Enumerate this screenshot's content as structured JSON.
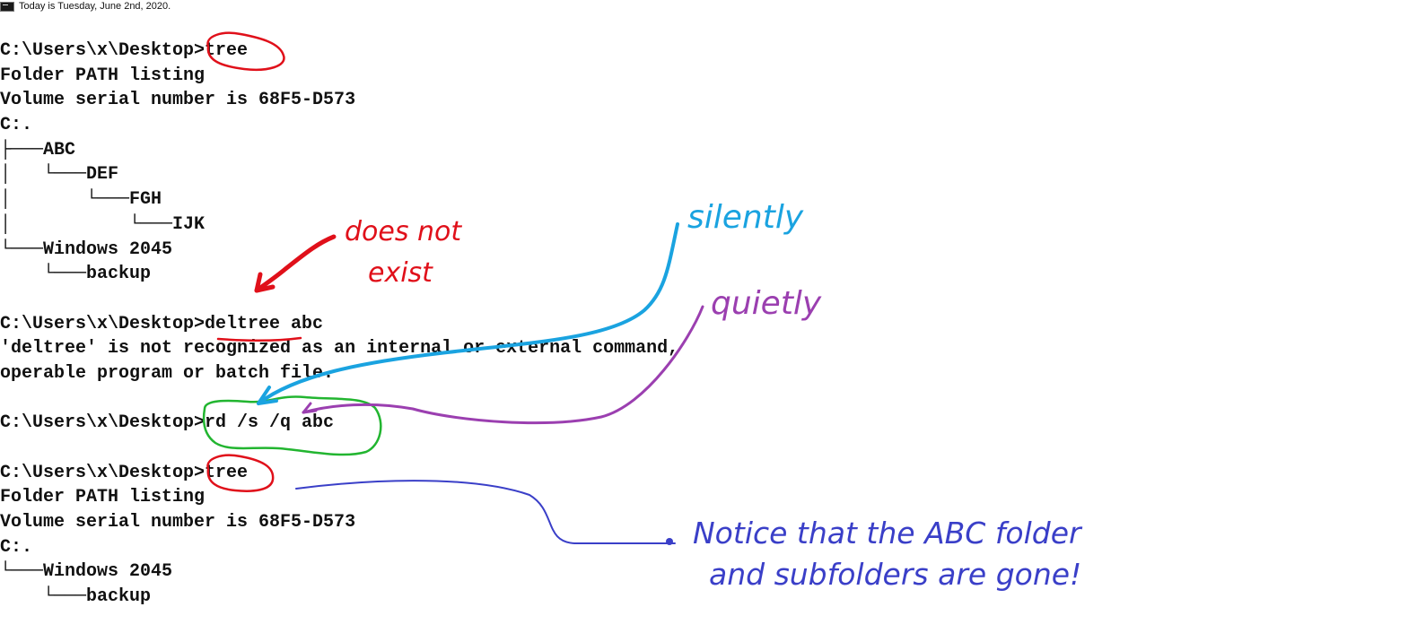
{
  "title_bar": {
    "icon": "cmd-icon",
    "text": "Today is Tuesday, June 2nd, 2020."
  },
  "console_lines": [
    "C:\\Users\\x\\Desktop>tree",
    "Folder PATH listing",
    "Volume serial number is 68F5-D573",
    "C:.",
    "├───ABC",
    "│   └───DEF",
    "│       └───FGH",
    "│           └───IJK",
    "└───Windows 2045",
    "    └───backup",
    "",
    "C:\\Users\\x\\Desktop>deltree abc",
    "'deltree' is not recognized as an internal or external command,",
    "operable program or batch file.",
    "",
    "C:\\Users\\x\\Desktop>rd /s /q abc",
    "",
    "C:\\Users\\x\\Desktop>tree",
    "Folder PATH listing",
    "Volume serial number is 68F5-D573",
    "C:.",
    "└───Windows 2045",
    "    └───backup"
  ],
  "annotations": {
    "does_not_exist": {
      "line1": "does not",
      "line2": "exist",
      "color": "#e0101a"
    },
    "silently": {
      "text": "silently",
      "color": "#1aa3e0"
    },
    "quietly": {
      "text": "quietly",
      "color": "#9b3fb0"
    },
    "notice": {
      "line1": "Notice that the ABC folder",
      "line2": "and subfolders are gone!",
      "color": "#3a3fc8"
    },
    "rd_circle_color": "#22b530",
    "tree_circle_color": "#e0101a"
  }
}
